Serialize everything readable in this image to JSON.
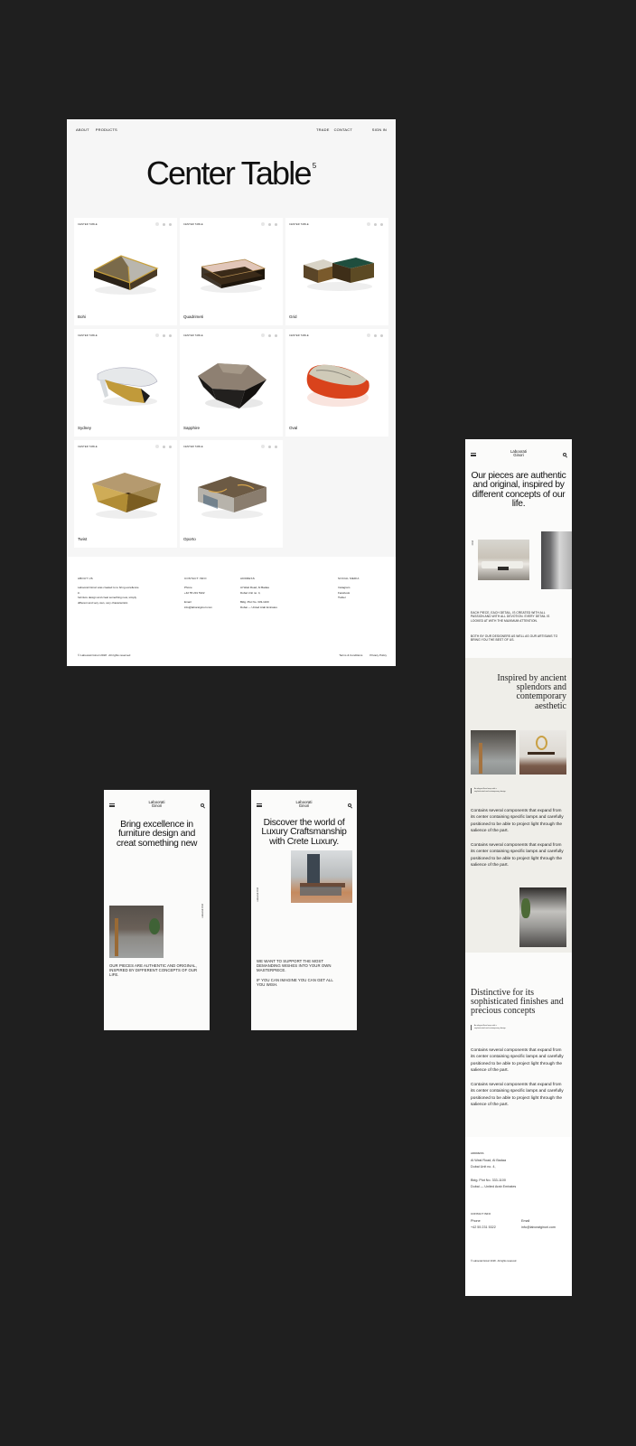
{
  "desktop": {
    "nav": {
      "left": [
        "ABOUT",
        "PRODUCTS"
      ],
      "right": [
        "TRADE",
        "CONTACT"
      ],
      "signin": "SIGN IN"
    },
    "title": "Center Table",
    "count": "5",
    "products": [
      {
        "category": "CENTER TABLE",
        "name": "Bohi",
        "icon": "glass-gold-table-image"
      },
      {
        "category": "CENTER TABLE",
        "name": "Quadrimeti",
        "icon": "bronze-glass-table-image"
      },
      {
        "category": "CENTER TABLE",
        "name": "Grid",
        "icon": "nesting-tables-image"
      },
      {
        "category": "CENTER TABLE",
        "name": "Sydney",
        "icon": "sculptural-table-image"
      },
      {
        "category": "CENTER TABLE",
        "name": "Sapphire",
        "icon": "faceted-table-image"
      },
      {
        "category": "CENTER TABLE",
        "name": "Oval",
        "icon": "oval-table-image"
      },
      {
        "category": "CENTER TABLE",
        "name": "Twist",
        "icon": "twist-table-image"
      },
      {
        "category": "CENTER TABLE",
        "name": "Oporto",
        "icon": "oporto-table-image"
      }
    ],
    "footer": {
      "about": {
        "heading": "ABOUT US",
        "text": [
          "Laboorati Ginori was created to to bring excellence in",
          "furniture design and creat something new, simply",
          "different and very own, very characteristic."
        ]
      },
      "contact": {
        "heading": "CONTACT INFO",
        "phone_label": "Phone",
        "phone": "+42 55 231 5322",
        "email_label": "Email",
        "email": "info@laboratginori.com"
      },
      "address": {
        "heading": "ADDRESS",
        "lines": [
          "Al Wasl Road, Al Badaa",
          "Dubai Unit no. 4,",
          "",
          "Bldg. Plot No. 333-1100",
          "Dubai — United Arab Emirates"
        ]
      },
      "social": {
        "heading": "SOCIAL MEDIA",
        "links": [
          "Instagram",
          "Facebook",
          "Twitter"
        ]
      },
      "copyright": "© Laboorati Ginori 2018 . All rights reserved",
      "legal": [
        "Terms & Conditions",
        "Privacy Policy"
      ]
    }
  },
  "mobile": {
    "logo": [
      "Laboorati",
      "Ginori"
    ],
    "screen1": {
      "headline": "Bring excellence in furniture design and creat something new",
      "side_label": "Laboorati 2018",
      "caps": "OUR PIECES ARE AUTHENTIC AND ORIGINAL, INSPIRED BY DIFFERENT CONCEPTS OF OUR LIFE."
    },
    "screen2": {
      "headline": "Discover the world of Luxury Craftsmanship with Crete Luxury.",
      "side_label": "Laboorati 2018",
      "caps1": "WE WANT TO SUPPORT THE MOST DEMANDING WISHES INTO YOUR OWN MASTERPIECE.",
      "caps2": "IF YOU CAN IMAGINE YOU CAN GET ALL YOU WISH."
    },
    "screen3": {
      "headline": "Our pieces are authentic and original, inspired by different concepts of our life.",
      "side_label": "2018",
      "caps1": "EACH PIECE, EACH DETAIL, IS CREATED WITH ALL PASSION AND WITH ALL DEVOTION. EVERY DETAIL IS LOOKED AT WITH THE MAXIMUM ATTENTION.",
      "caps2": "BOTH BY OUR DESIGNERS AS WELL AS OUR ARTISANS TO BRING YOU THE BEST OF US.",
      "serif1": "Inspired by ancient splendors and contemporary aesthetic",
      "caption1": [
        "An elegant floor lamp with a",
        "sophisticated and contemporary design"
      ],
      "para": "Contains several components that expand from its center containing specific lamps and carefully positioned to be able to project light through the salience of the part.",
      "serif2": "Distinctive for its sophisticated finishes and precious concepts",
      "caption2": [
        "An elegant floor lamp with a",
        "sophisticated and contemporary design"
      ],
      "footer": {
        "address_heading": "ADDRESS",
        "address": [
          "Al Wasl Road, Al Badaa",
          "Dubai Unit no. 4,",
          "",
          "Bldg. Plot No. 333-1100",
          "Dubai — United Arab Emirates"
        ],
        "contact_heading": "CONTACT INFO",
        "phone_label": "Phone",
        "phone": "+42 55 231 5322",
        "email_label": "Email",
        "email": "info@laboratginori.com",
        "copyright": "© Laboorati Ginori 2018 . All rights reserved"
      }
    }
  }
}
